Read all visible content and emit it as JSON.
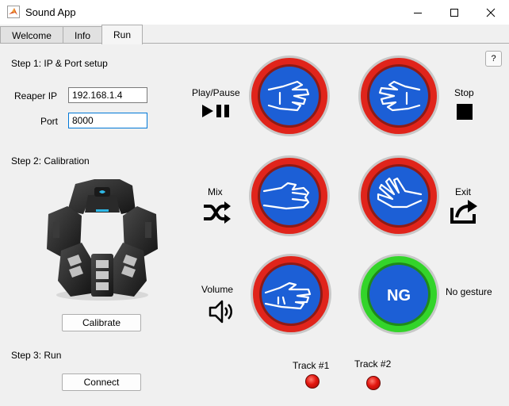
{
  "window": {
    "title": "Sound App",
    "controls": [
      "minimize-icon",
      "maximize-icon",
      "close-icon"
    ]
  },
  "tabs": [
    {
      "label": "Welcome"
    },
    {
      "label": "Info"
    },
    {
      "label": "Run",
      "active": true
    }
  ],
  "help_label": "?",
  "step1": {
    "heading": "Step 1: IP & Port setup",
    "ip_label": "Reaper IP",
    "ip_value": "192.168.1.4",
    "port_label": "Port",
    "port_value": "8000"
  },
  "step2": {
    "heading": "Step 2: Calibration",
    "calibrate_label": "Calibrate"
  },
  "step3": {
    "heading": "Step 3: Run",
    "connect_label": "Connect"
  },
  "gestures": {
    "play_pause": {
      "label": "Play/Pause",
      "icon": "play-pause-icon",
      "gesture": "wave-in-hand"
    },
    "stop": {
      "label": "Stop",
      "icon": "stop-icon",
      "gesture": "wave-out-hand"
    },
    "mix": {
      "label": "Mix",
      "icon": "shuffle-icon",
      "gesture": "fist-hand"
    },
    "exit": {
      "label": "Exit",
      "icon": "share-exit-icon",
      "gesture": "fingers-spread-hand"
    },
    "volume": {
      "label": "Volume",
      "icon": "speaker-icon",
      "gesture": "double-tap-hand"
    },
    "no_gesture": {
      "label": "No gesture",
      "badge": "NG"
    }
  },
  "tracks": [
    {
      "label": "Track #1",
      "status_color": "#e3160f"
    },
    {
      "label": "Track #2",
      "status_color": "#e3160f"
    }
  ],
  "colors": {
    "ring_red": "#e0241b",
    "ring_green": "#33d42a",
    "button_blue": "#1c5fd6"
  }
}
